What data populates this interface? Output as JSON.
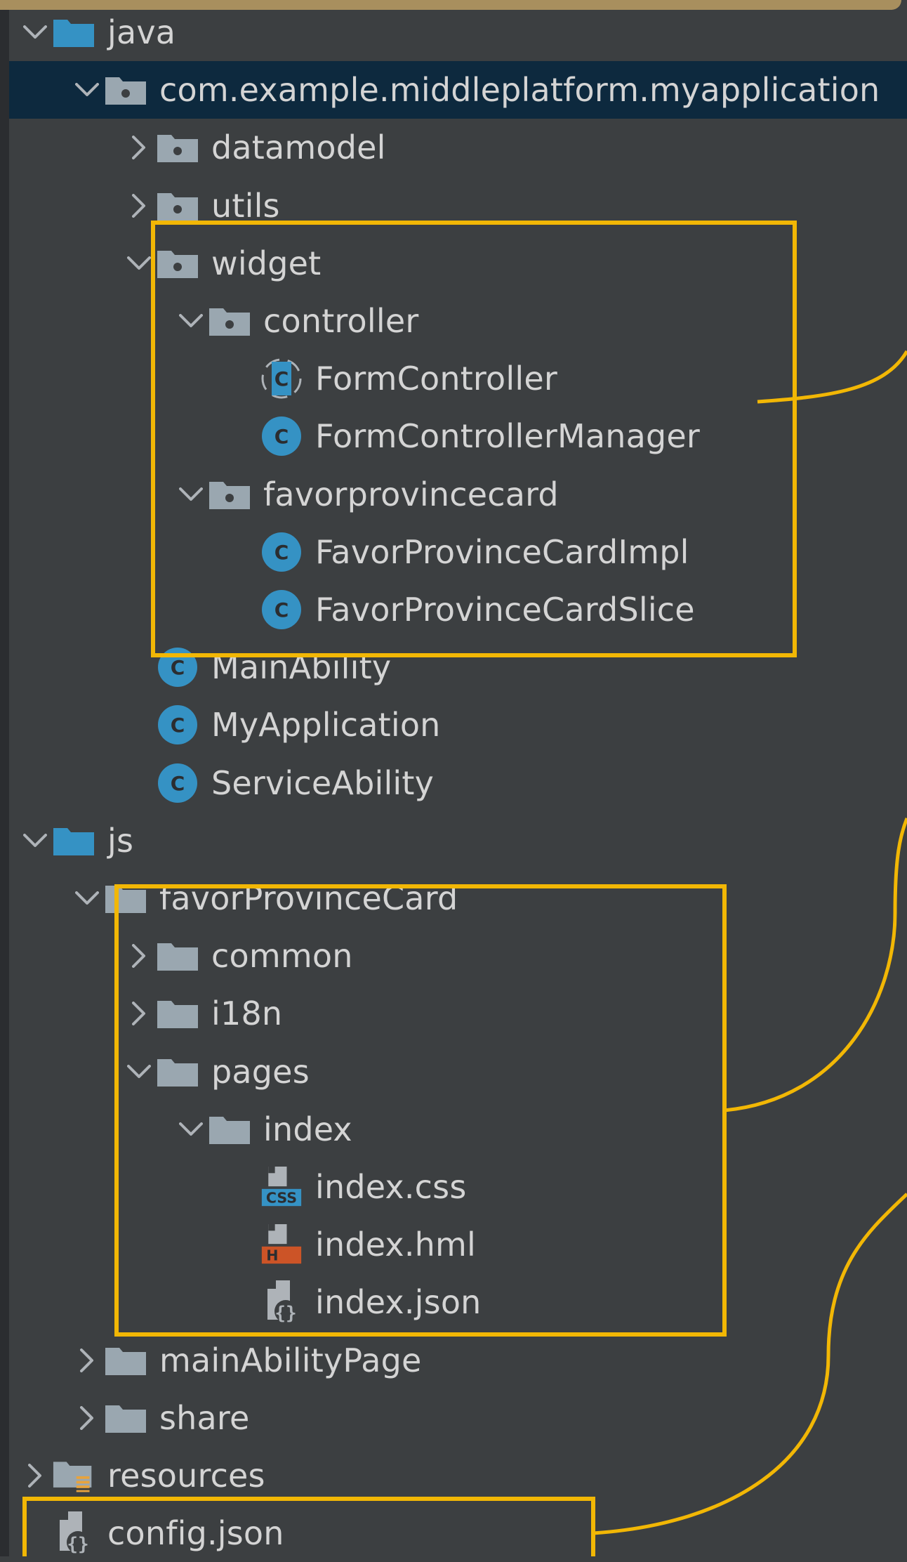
{
  "tree": {
    "rows": [
      {
        "label": "java",
        "icon": "folder-blue-icon",
        "chevron": "expanded"
      },
      {
        "label": "com.example.middleplatform.myapplication",
        "icon": "package-icon",
        "chevron": "expanded",
        "selected": true
      },
      {
        "label": "datamodel",
        "icon": "package-icon",
        "chevron": "collapsed"
      },
      {
        "label": "utils",
        "icon": "package-icon",
        "chevron": "collapsed"
      },
      {
        "label": "widget",
        "icon": "package-icon",
        "chevron": "expanded"
      },
      {
        "label": "controller",
        "icon": "package-icon",
        "chevron": "expanded"
      },
      {
        "label": "FormController",
        "icon": "abstract-class-icon",
        "chevron": "none"
      },
      {
        "label": "FormControllerManager",
        "icon": "class-icon",
        "chevron": "none"
      },
      {
        "label": "favorprovincecard",
        "icon": "package-icon",
        "chevron": "expanded"
      },
      {
        "label": "FavorProvinceCardImpl",
        "icon": "class-icon",
        "chevron": "none"
      },
      {
        "label": "FavorProvinceCardSlice",
        "icon": "class-icon",
        "chevron": "none"
      },
      {
        "label": "MainAbility",
        "icon": "class-icon",
        "chevron": "none"
      },
      {
        "label": "MyApplication",
        "icon": "class-icon",
        "chevron": "none"
      },
      {
        "label": "ServiceAbility",
        "icon": "class-icon",
        "chevron": "none"
      },
      {
        "label": "js",
        "icon": "folder-blue-icon",
        "chevron": "expanded"
      },
      {
        "label": "favorProvinceCard",
        "icon": "folder-icon",
        "chevron": "expanded"
      },
      {
        "label": "common",
        "icon": "folder-icon",
        "chevron": "collapsed"
      },
      {
        "label": "i18n",
        "icon": "folder-icon",
        "chevron": "collapsed"
      },
      {
        "label": "pages",
        "icon": "folder-icon",
        "chevron": "expanded"
      },
      {
        "label": "index",
        "icon": "folder-icon",
        "chevron": "expanded"
      },
      {
        "label": "index.css",
        "icon": "css-file-icon",
        "chevron": "none"
      },
      {
        "label": "index.hml",
        "icon": "hml-file-icon",
        "chevron": "none"
      },
      {
        "label": "index.json",
        "icon": "json-file-icon",
        "chevron": "none"
      },
      {
        "label": "mainAbilityPage",
        "icon": "folder-icon",
        "chevron": "collapsed"
      },
      {
        "label": "share",
        "icon": "folder-icon",
        "chevron": "collapsed"
      },
      {
        "label": "resources",
        "icon": "resources-folder-icon",
        "chevron": "collapsed"
      },
      {
        "label": "config.json",
        "icon": "json-file-icon",
        "chevron": "none"
      }
    ]
  },
  "icons": {
    "class_badge_letter": "C",
    "css_badge_text": "CSS",
    "hml_badge_text": "H"
  },
  "colors": {
    "background": "#3c3f41",
    "selection": "#0d293e",
    "text": "#d4d4d4",
    "highlight": "#f2b705",
    "class_icon": "#3592c4",
    "folder_gray": "#9aa7b0",
    "folder_blue": "#3592c4",
    "hml_icon": "#cc5427"
  }
}
